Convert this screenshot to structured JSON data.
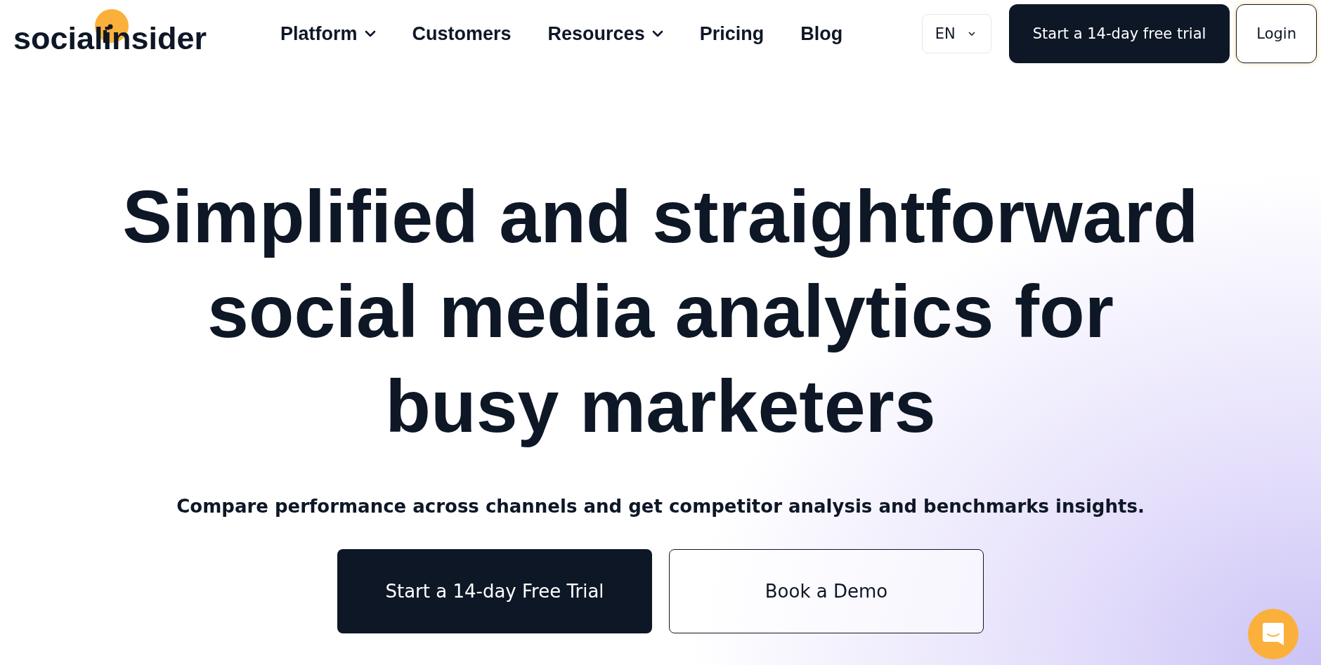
{
  "logo": {
    "text": "socialinsider"
  },
  "nav": [
    {
      "label": "Platform",
      "dropdown": true
    },
    {
      "label": "Customers",
      "dropdown": false
    },
    {
      "label": "Resources",
      "dropdown": true
    },
    {
      "label": "Pricing",
      "dropdown": false
    },
    {
      "label": "Blog",
      "dropdown": false
    }
  ],
  "language": {
    "value": "EN"
  },
  "header_buttons": [
    {
      "label": "Start a 14-day free trial",
      "kind": "primary"
    },
    {
      "label": "Login",
      "kind": "outline"
    }
  ],
  "hero": {
    "title": [
      "Simplified and straightforward",
      "social media analytics for",
      "busy marketers"
    ],
    "subtitle": "Compare performance across channels and get competitor analysis and benchmarks insights.",
    "buttons": [
      {
        "label": "Start a 14-day Free Trial",
        "kind": "primary"
      },
      {
        "label": "Book a Demo",
        "kind": "outline"
      }
    ]
  }
}
